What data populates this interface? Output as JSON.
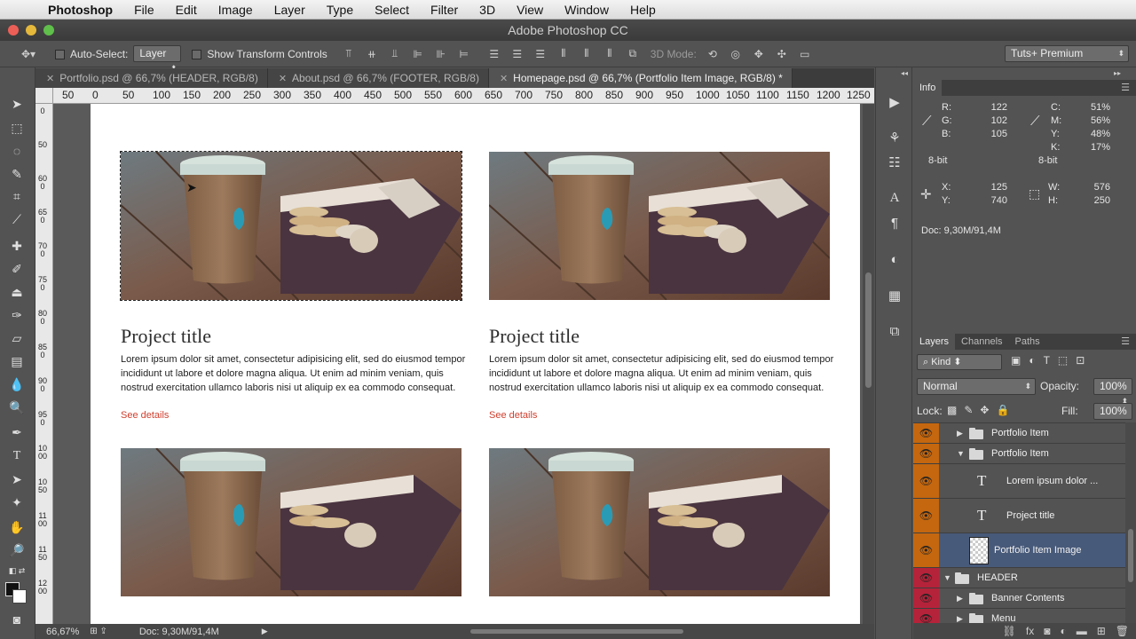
{
  "menubar": {
    "app_name": "Photoshop",
    "items": [
      "File",
      "Edit",
      "Image",
      "Layer",
      "Type",
      "Select",
      "Filter",
      "3D",
      "View",
      "Window",
      "Help"
    ]
  },
  "window": {
    "title": "Adobe Photoshop CC"
  },
  "options_bar": {
    "auto_select_label": "Auto-Select:",
    "auto_select_value": "Layer",
    "show_transform_label": "Show Transform Controls",
    "three_d_mode_label": "3D Mode:",
    "workspace": "Tuts+ Premium"
  },
  "tabs": [
    {
      "label": "Portfolio.psd @ 66,7% (HEADER, RGB/8)",
      "active": false
    },
    {
      "label": "About.psd @ 66,7% (FOOTER, RGB/8)",
      "active": false
    },
    {
      "label": "Homepage.psd @ 66,7% (Portfolio Item Image, RGB/8) *",
      "active": true
    }
  ],
  "ruler": {
    "h_ticks": [
      "50",
      "0",
      "50",
      "100",
      "150",
      "200",
      "250",
      "300",
      "350",
      "400",
      "450",
      "500",
      "550",
      "600",
      "650",
      "700",
      "750",
      "800",
      "850",
      "900",
      "950",
      "1000",
      "1050",
      "1100",
      "1150",
      "1200",
      "1250"
    ],
    "v_ticks": [
      "0",
      "50",
      "600",
      "650",
      "700",
      "750",
      "800",
      "850",
      "900",
      "950",
      "1000",
      "1050",
      "1100",
      "1150",
      "1200"
    ]
  },
  "document": {
    "cards": [
      {
        "title": "Project title",
        "body": "Lorem ipsum dolor sit amet, consectetur adipisicing elit, sed do eiusmod tempor incididunt ut labore et dolore magna aliqua. Ut enim ad minim veniam, quis nostrud exercitation ullamco laboris nisi ut aliquip ex ea commodo consequat.",
        "link": "See details"
      },
      {
        "title": "Project title",
        "body": "Lorem ipsum dolor sit amet, consectetur adipisicing elit, sed do eiusmod tempor incididunt ut labore et dolore magna aliqua. Ut enim ad minim veniam, quis nostrud exercitation ullamco laboris nisi ut aliquip ex ea commodo consequat.",
        "link": "See details"
      }
    ],
    "link_color": "#d0402f"
  },
  "status_bar": {
    "zoom": "66,67%",
    "doc": "Doc: 9,30M/91,4M"
  },
  "info_panel": {
    "tab": "Info",
    "r_label": "R:",
    "r": "122",
    "g_label": "G:",
    "g": "102",
    "b_label": "B:",
    "b": "105",
    "c_label": "C:",
    "c": "51%",
    "m_label": "M:",
    "m": "56%",
    "y_label": "Y:",
    "y": "48%",
    "k_label": "K:",
    "k": "17%",
    "bit_left": "8-bit",
    "bit_right": "8-bit",
    "x_label": "X:",
    "x": "125",
    "ypos_label": "Y:",
    "ypos": "740",
    "w_label": "W:",
    "w": "576",
    "h_label": "H:",
    "h": "250",
    "doc": "Doc: 9,30M/91,4M"
  },
  "layers_panel": {
    "tabs": [
      "Layers",
      "Channels",
      "Paths"
    ],
    "filter": "Kind",
    "blend_mode": "Normal",
    "opacity_label": "Opacity:",
    "opacity": "100%",
    "lock_label": "Lock:",
    "fill_label": "Fill:",
    "fill": "100%",
    "layers": [
      {
        "name": "Portfolio Item",
        "type": "group",
        "expanded": false,
        "eye": "orange"
      },
      {
        "name": "Portfolio Item",
        "type": "group",
        "expanded": true,
        "eye": "orange"
      },
      {
        "name": "Lorem ipsum dolor ...",
        "type": "text",
        "eye": "orange"
      },
      {
        "name": "Project title",
        "type": "text",
        "eye": "orange"
      },
      {
        "name": "Portfolio Item Image",
        "type": "image",
        "selected": true,
        "eye": "orange"
      },
      {
        "name": "HEADER",
        "type": "group",
        "expanded": true,
        "eye": "red"
      },
      {
        "name": "Banner Contents",
        "type": "group",
        "expanded": false,
        "eye": "red"
      },
      {
        "name": "Menu",
        "type": "group",
        "expanded": false,
        "eye": "red"
      }
    ],
    "colors": {
      "orange": "#c4670f",
      "red": "#b5233a",
      "selected": "#485a7a"
    }
  }
}
